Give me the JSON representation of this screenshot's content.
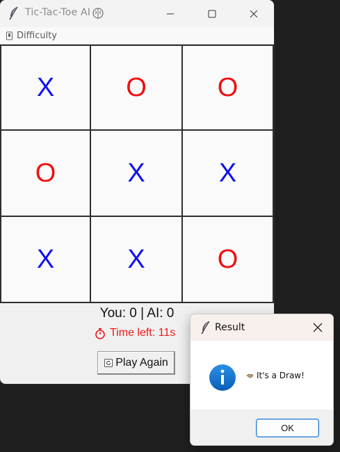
{
  "window": {
    "title": "Tic-Tac-Toe AI",
    "title_icon": "brain-icon",
    "app_icon": "feather-icon"
  },
  "menubar": {
    "difficulty_label": "Difficulty",
    "difficulty_icon": "pin-icon"
  },
  "board": {
    "cells": [
      {
        "mark": "X"
      },
      {
        "mark": "O"
      },
      {
        "mark": "O"
      },
      {
        "mark": "O"
      },
      {
        "mark": "X"
      },
      {
        "mark": "X"
      },
      {
        "mark": "X"
      },
      {
        "mark": "X"
      },
      {
        "mark": "O"
      }
    ],
    "x_color": "#1010f0",
    "o_color": "#f01010"
  },
  "status": {
    "score": "You: 0  |  AI: 0",
    "timer_icon": "stopwatch-icon",
    "timer_text": "Time left: 11s",
    "timer_color": "#f01818",
    "play_again_label": "Play Again",
    "play_again_icon": "restart-icon"
  },
  "dialog": {
    "title": "Result",
    "icon": "info-icon",
    "message_icon": "handshake-icon",
    "message": "It's a Draw!",
    "ok_label": "OK"
  }
}
